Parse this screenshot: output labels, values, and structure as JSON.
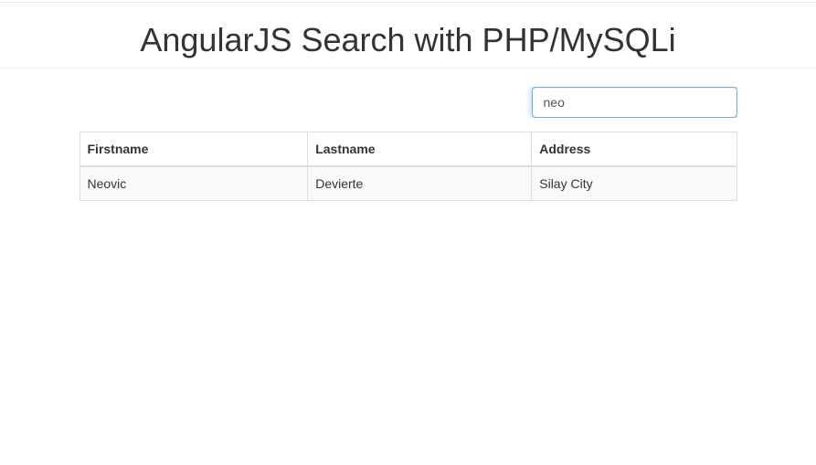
{
  "header": {
    "title": "AngularJS Search with PHP/MySQLi"
  },
  "search": {
    "value": "neo"
  },
  "table": {
    "headers": {
      "firstname": "Firstname",
      "lastname": "Lastname",
      "address": "Address"
    },
    "rows": [
      {
        "firstname": "Neovic",
        "lastname": "Devierte",
        "address": "Silay City"
      }
    ]
  }
}
